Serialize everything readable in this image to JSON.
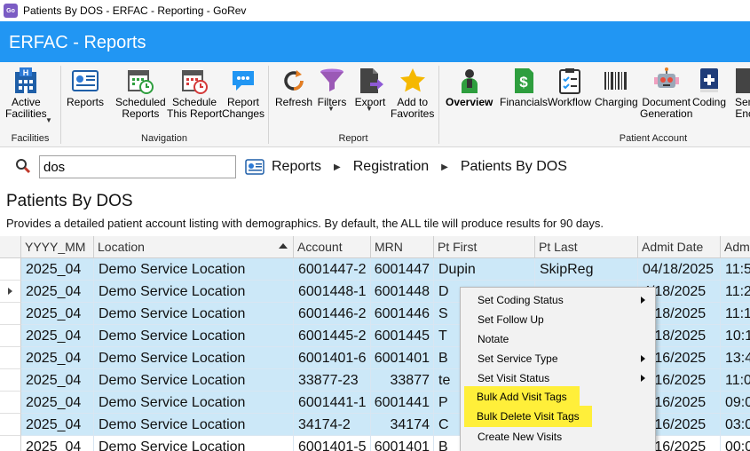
{
  "window": {
    "title": "Patients By DOS - ERFAC - Reporting - GoRev",
    "app_icon": "GoRev"
  },
  "header": {
    "app_name": "ERFAC - Reports",
    "bg_color": "#2196f3"
  },
  "ribbon": {
    "buttons": [
      {
        "id": "active-facilities",
        "label": "Active",
        "label2": "Facilities",
        "icon": "building-h-icon"
      },
      {
        "id": "reports",
        "label": "Reports",
        "icon": "report-icon"
      },
      {
        "id": "scheduled-reports",
        "label": "Scheduled",
        "label2": "Reports",
        "icon": "calendar-clock-icon"
      },
      {
        "id": "schedule-this-report",
        "label": "Schedule",
        "label2": "This Report",
        "icon": "calendar-clock-red-icon"
      },
      {
        "id": "report-changes",
        "label": "Report",
        "label2": "Changes",
        "icon": "chat-bubble-icon"
      },
      {
        "id": "refresh",
        "label": "Refresh",
        "icon": "refresh-icon"
      },
      {
        "id": "filters",
        "label": "Filters",
        "icon": "funnel-icon"
      },
      {
        "id": "export",
        "label": "Export",
        "icon": "export-icon"
      },
      {
        "id": "add-to-favorites",
        "label": "Add to",
        "label2": "Favorites",
        "icon": "star-icon"
      },
      {
        "id": "overview",
        "label": "Overview",
        "icon": "patient-icon"
      },
      {
        "id": "financials",
        "label": "Financials",
        "icon": "dollar-doc-icon"
      },
      {
        "id": "workflow",
        "label": "Workflow",
        "icon": "clipboard-check-icon"
      },
      {
        "id": "charging",
        "label": "Charging",
        "icon": "barcode-icon"
      },
      {
        "id": "document-generation",
        "label": "Document",
        "label2": "Generation",
        "icon": "robot-icon"
      },
      {
        "id": "coding",
        "label": "Coding",
        "icon": "book-plus-icon"
      },
      {
        "id": "send-encounters",
        "label": "Send",
        "label2": "Enco",
        "icon": "send-icon"
      }
    ],
    "groups": {
      "facilities": "Facilities",
      "navigation": "Navigation",
      "report": "Report",
      "patient_account": "Patient Account"
    }
  },
  "search": {
    "value": "dos"
  },
  "breadcrumb": {
    "items": [
      "Reports",
      "Registration",
      "Patients By DOS"
    ]
  },
  "page": {
    "title": "Patients By DOS",
    "description": "Provides a detailed patient account listing with demographics. By default, the ALL tile will produce results for 90 days."
  },
  "grid": {
    "columns": [
      "YYYY_MM",
      "Location",
      "Account",
      "MRN",
      "Pt First",
      "Pt Last",
      "Admit Date",
      "Adm"
    ],
    "rows": [
      [
        "2025_04",
        "Demo Service Location",
        "6001447-2",
        "6001447",
        "Dupin",
        "SkipReg",
        "04/18/2025",
        "11:5"
      ],
      [
        "2025_04",
        "Demo Service Location",
        "6001448-1",
        "6001448",
        "D",
        "",
        "4/18/2025",
        "11:2"
      ],
      [
        "2025_04",
        "Demo Service Location",
        "6001446-2",
        "6001446",
        "S",
        "",
        "4/18/2025",
        "11:1"
      ],
      [
        "2025_04",
        "Demo Service Location",
        "6001445-2",
        "6001445",
        "T",
        "",
        "4/18/2025",
        "10:1"
      ],
      [
        "2025_04",
        "Demo Service Location",
        "6001401-6",
        "6001401",
        "B",
        "",
        "4/16/2025",
        "13:4"
      ],
      [
        "2025_04",
        "Demo Service Location",
        "33877-23",
        "33877",
        "te",
        "",
        "4/16/2025",
        "11:0"
      ],
      [
        "2025_04",
        "Demo Service Location",
        "6001441-1",
        "6001441",
        "P",
        "",
        "4/16/2025",
        "09:0"
      ],
      [
        "2025_04",
        "Demo Service Location",
        "34174-2",
        "34174",
        "C",
        "",
        "4/16/2025",
        "03:0"
      ],
      [
        "2025_04",
        "Demo Service Location",
        "6001401-5",
        "6001401",
        "B",
        "",
        "4/16/2025",
        "00:0"
      ]
    ]
  },
  "context_menu": {
    "items": [
      {
        "label": "Set Coding Status",
        "submenu": true,
        "highlighted": false
      },
      {
        "label": "Set Follow Up",
        "submenu": false,
        "highlighted": false
      },
      {
        "label": "Notate",
        "submenu": false,
        "highlighted": false
      },
      {
        "label": "Set Service Type",
        "submenu": true,
        "highlighted": false
      },
      {
        "label": "Set Visit Status",
        "submenu": true,
        "highlighted": false
      },
      {
        "label": "Bulk Add Visit Tags",
        "submenu": false,
        "highlighted": true
      },
      {
        "label": "Bulk Delete Visit Tags",
        "submenu": false,
        "highlighted": true
      },
      {
        "label": "Create New Visits",
        "submenu": false,
        "highlighted": false
      }
    ],
    "highlight_color": "#ffef3a"
  },
  "colors": {
    "selected_row": "#cce8f8",
    "accent": "#2196f3"
  }
}
